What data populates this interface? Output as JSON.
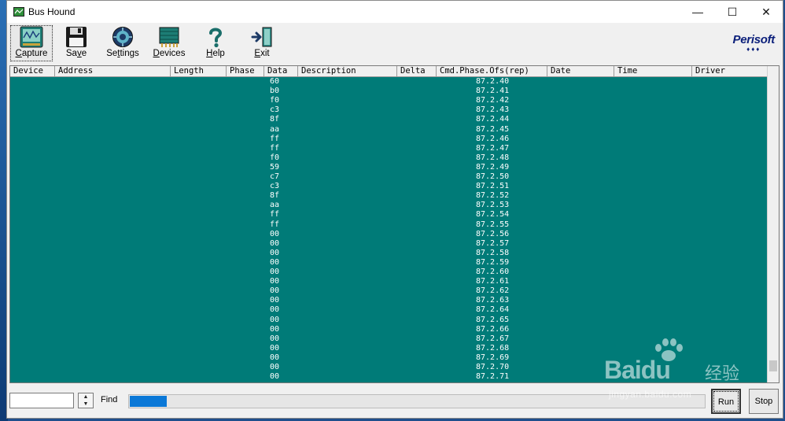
{
  "window": {
    "title": "Bus Hound"
  },
  "window_controls": {
    "minimize": "—",
    "maximize": "☐",
    "close": "✕"
  },
  "toolbar": {
    "capture": {
      "first": "C",
      "rest": "apture"
    },
    "save": {
      "pre": "Sa",
      "u": "v",
      "post": "e"
    },
    "settings": {
      "pre": "Se",
      "u": "t",
      "post": "tings"
    },
    "devices": {
      "first": "D",
      "rest": "evices"
    },
    "help": {
      "first": "H",
      "rest": "elp"
    },
    "exit": {
      "first": "E",
      "rest": "xit"
    }
  },
  "logo": {
    "brand": "Perisoft",
    "dots": "♦♦♦"
  },
  "columns": [
    "Device",
    "Address",
    "Length",
    "Phase",
    "Data",
    "Description",
    "Delta",
    "Cmd.Phase.Ofs(rep)",
    "Date",
    "Time",
    "Driver"
  ],
  "rows": [
    {
      "data": "60",
      "cmd": "87.2.40"
    },
    {
      "data": "b0",
      "cmd": "87.2.41"
    },
    {
      "data": "f0",
      "cmd": "87.2.42"
    },
    {
      "data": "c3",
      "cmd": "87.2.43"
    },
    {
      "data": "8f",
      "cmd": "87.2.44"
    },
    {
      "data": "aa",
      "cmd": "87.2.45"
    },
    {
      "data": "ff",
      "cmd": "87.2.46"
    },
    {
      "data": "ff",
      "cmd": "87.2.47"
    },
    {
      "data": "f0",
      "cmd": "87.2.48"
    },
    {
      "data": "59",
      "cmd": "87.2.49"
    },
    {
      "data": "c7",
      "cmd": "87.2.50"
    },
    {
      "data": "c3",
      "cmd": "87.2.51"
    },
    {
      "data": "8f",
      "cmd": "87.2.52"
    },
    {
      "data": "aa",
      "cmd": "87.2.53"
    },
    {
      "data": "ff",
      "cmd": "87.2.54"
    },
    {
      "data": "ff",
      "cmd": "87.2.55"
    },
    {
      "data": "00",
      "cmd": "87.2.56"
    },
    {
      "data": "00",
      "cmd": "87.2.57"
    },
    {
      "data": "00",
      "cmd": "87.2.58"
    },
    {
      "data": "00",
      "cmd": "87.2.59"
    },
    {
      "data": "00",
      "cmd": "87.2.60"
    },
    {
      "data": "00",
      "cmd": "87.2.61"
    },
    {
      "data": "00",
      "cmd": "87.2.62"
    },
    {
      "data": "00",
      "cmd": "87.2.63"
    },
    {
      "data": "00",
      "cmd": "87.2.64"
    },
    {
      "data": "00",
      "cmd": "87.2.65"
    },
    {
      "data": "00",
      "cmd": "87.2.66"
    },
    {
      "data": "00",
      "cmd": "87.2.67"
    },
    {
      "data": "00",
      "cmd": "87.2.68"
    },
    {
      "data": "00",
      "cmd": "87.2.69"
    },
    {
      "data": "00",
      "cmd": "87.2.70"
    },
    {
      "data": "00",
      "cmd": "87.2.71"
    }
  ],
  "status": {
    "find_label": "Find",
    "find_value": "",
    "progress_fraction": 0.065,
    "run_label": "Run",
    "stop_label": "Stop"
  },
  "watermark": {
    "brand": "Bai",
    "du": "du",
    "cn": "经验",
    "url": "jingyan.baidu.com"
  },
  "colors": {
    "grid_background": "#007b78",
    "grid_text": "#ffffff",
    "progress_fill": "#0a78d7"
  }
}
